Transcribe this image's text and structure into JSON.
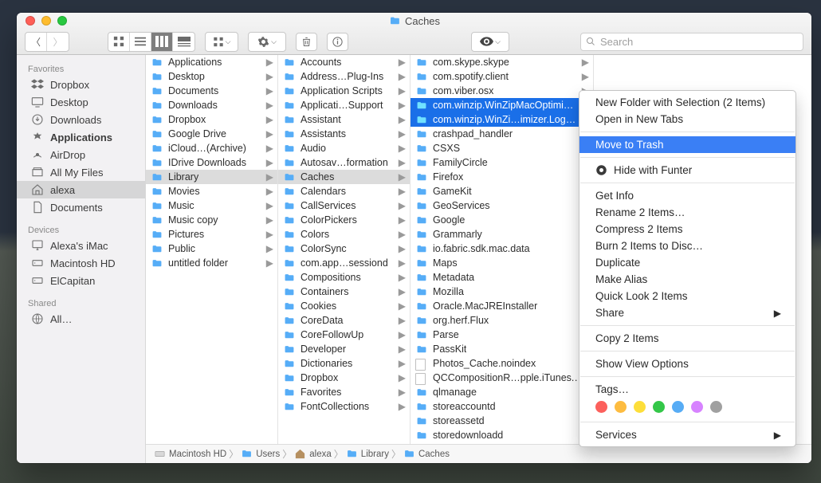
{
  "window": {
    "title": "Caches"
  },
  "search": {
    "placeholder": "Search"
  },
  "sidebar": {
    "sections": [
      {
        "header": "Favorites",
        "items": [
          {
            "icon": "dropbox",
            "label": "Dropbox"
          },
          {
            "icon": "desktop",
            "label": "Desktop"
          },
          {
            "icon": "downloads",
            "label": "Downloads"
          },
          {
            "icon": "apps",
            "label": "Applications",
            "bold": true
          },
          {
            "icon": "airdrop",
            "label": "AirDrop"
          },
          {
            "icon": "allfiles",
            "label": "All My Files"
          },
          {
            "icon": "home",
            "label": "alexa",
            "selected": true
          },
          {
            "icon": "doc",
            "label": "Documents"
          }
        ]
      },
      {
        "header": "Devices",
        "items": [
          {
            "icon": "imac",
            "label": "Alexa's iMac"
          },
          {
            "icon": "hd",
            "label": "Macintosh HD"
          },
          {
            "icon": "hd",
            "label": "ElCapitan"
          }
        ]
      },
      {
        "header": "Shared",
        "items": [
          {
            "icon": "globe",
            "label": "All…"
          }
        ]
      }
    ]
  },
  "columns": [
    {
      "items": [
        {
          "t": "folder",
          "label": "Applications",
          "arrow": true
        },
        {
          "t": "folder",
          "label": "Desktop",
          "arrow": true
        },
        {
          "t": "folder",
          "label": "Documents",
          "arrow": true
        },
        {
          "t": "folder",
          "label": "Downloads",
          "arrow": true
        },
        {
          "t": "folder",
          "label": "Dropbox",
          "arrow": true
        },
        {
          "t": "folder",
          "label": "Google Drive",
          "arrow": true
        },
        {
          "t": "folder",
          "label": "iCloud…(Archive)",
          "arrow": true
        },
        {
          "t": "folder",
          "label": "IDrive Downloads",
          "arrow": true
        },
        {
          "t": "folder",
          "label": "Library",
          "arrow": true,
          "selected": "grey"
        },
        {
          "t": "folder",
          "label": "Movies",
          "arrow": true
        },
        {
          "t": "folder",
          "label": "Music",
          "arrow": true
        },
        {
          "t": "folder",
          "label": "Music copy",
          "arrow": true
        },
        {
          "t": "img",
          "label": "Pictures",
          "arrow": true
        },
        {
          "t": "folder",
          "label": "Public",
          "arrow": true
        },
        {
          "t": "folder",
          "label": "untitled folder",
          "arrow": true
        }
      ]
    },
    {
      "items": [
        {
          "t": "folder",
          "label": "Accounts",
          "arrow": true
        },
        {
          "t": "folder",
          "label": "Address…Plug-Ins",
          "arrow": true
        },
        {
          "t": "folder",
          "label": "Application Scripts",
          "arrow": true
        },
        {
          "t": "folder",
          "label": "Applicati…Support",
          "arrow": true
        },
        {
          "t": "folder",
          "label": "Assistant",
          "arrow": true
        },
        {
          "t": "folder",
          "label": "Assistants",
          "arrow": true
        },
        {
          "t": "folder",
          "label": "Audio",
          "arrow": true
        },
        {
          "t": "folder",
          "label": "Autosav…formation",
          "arrow": true
        },
        {
          "t": "folder",
          "label": "Caches",
          "arrow": true,
          "selected": "grey"
        },
        {
          "t": "folder",
          "label": "Calendars",
          "arrow": true
        },
        {
          "t": "folder",
          "label": "CallServices",
          "arrow": true
        },
        {
          "t": "folder",
          "label": "ColorPickers",
          "arrow": true
        },
        {
          "t": "folder",
          "label": "Colors",
          "arrow": true
        },
        {
          "t": "folder",
          "label": "ColorSync",
          "arrow": true
        },
        {
          "t": "folder",
          "label": "com.app…sessiond",
          "arrow": true
        },
        {
          "t": "folder",
          "label": "Compositions",
          "arrow": true
        },
        {
          "t": "folder",
          "label": "Containers",
          "arrow": true
        },
        {
          "t": "folder",
          "label": "Cookies",
          "arrow": true
        },
        {
          "t": "folder",
          "label": "CoreData",
          "arrow": true
        },
        {
          "t": "folder",
          "label": "CoreFollowUp",
          "arrow": true
        },
        {
          "t": "folder",
          "label": "Developer",
          "arrow": true
        },
        {
          "t": "folder",
          "label": "Dictionaries",
          "arrow": true
        },
        {
          "t": "folder",
          "label": "Dropbox",
          "arrow": true
        },
        {
          "t": "folder",
          "label": "Favorites",
          "arrow": true
        },
        {
          "t": "folder",
          "label": "FontCollections",
          "arrow": true
        }
      ]
    },
    {
      "items": [
        {
          "t": "folder",
          "label": "com.skype.skype",
          "arrow": true
        },
        {
          "t": "folder",
          "label": "com.spotify.client",
          "arrow": true
        },
        {
          "t": "folder",
          "label": "com.viber.osx",
          "arrow": true
        },
        {
          "t": "folder",
          "label": "com.winzip.WinZipMacOptimizer",
          "arrow": true,
          "selected": "blue"
        },
        {
          "t": "folder",
          "label": "com.winzip.WinZi…imizer.LoginHel",
          "arrow": true,
          "selected": "blue"
        },
        {
          "t": "folder",
          "label": "crashpad_handler",
          "arrow": true
        },
        {
          "t": "folder",
          "label": "CSXS",
          "arrow": true
        },
        {
          "t": "folder",
          "label": "FamilyCircle",
          "arrow": true
        },
        {
          "t": "folder",
          "label": "Firefox",
          "arrow": true
        },
        {
          "t": "folder",
          "label": "GameKit",
          "arrow": true
        },
        {
          "t": "folder",
          "label": "GeoServices",
          "arrow": true
        },
        {
          "t": "folder",
          "label": "Google",
          "arrow": true
        },
        {
          "t": "folder",
          "label": "Grammarly",
          "arrow": true
        },
        {
          "t": "folder",
          "label": "io.fabric.sdk.mac.data",
          "arrow": true
        },
        {
          "t": "folder",
          "label": "Maps",
          "arrow": true
        },
        {
          "t": "folder",
          "label": "Metadata",
          "arrow": true
        },
        {
          "t": "folder",
          "label": "Mozilla",
          "arrow": true
        },
        {
          "t": "folder",
          "label": "Oracle.MacJREInstaller",
          "arrow": true
        },
        {
          "t": "folder",
          "label": "org.herf.Flux",
          "arrow": true
        },
        {
          "t": "folder",
          "label": "Parse",
          "arrow": true
        },
        {
          "t": "folder",
          "label": "PassKit",
          "arrow": true
        },
        {
          "t": "doc",
          "label": "Photos_Cache.noindex"
        },
        {
          "t": "doc",
          "label": "QCCompositionR…pple.iTunes.cac"
        },
        {
          "t": "folder",
          "label": "qlmanage",
          "arrow": true
        },
        {
          "t": "folder",
          "label": "storeaccountd",
          "arrow": true
        },
        {
          "t": "folder",
          "label": "storeassetd",
          "arrow": true
        },
        {
          "t": "folder",
          "label": "storedownloadd",
          "arrow": true
        }
      ]
    }
  ],
  "pathbar": [
    {
      "icon": "hd",
      "label": "Macintosh HD"
    },
    {
      "icon": "folder",
      "label": "Users"
    },
    {
      "icon": "home",
      "label": "alexa"
    },
    {
      "icon": "folder",
      "label": "Library"
    },
    {
      "icon": "folder",
      "label": "Caches"
    }
  ],
  "contextmenu": {
    "groups": [
      [
        {
          "label": "New Folder with Selection (2 Items)"
        },
        {
          "label": "Open in New Tabs"
        }
      ],
      [
        {
          "label": "Move to Trash",
          "selected": true
        }
      ],
      [
        {
          "label": "Hide with Funter",
          "icon": "funter"
        }
      ],
      [
        {
          "label": "Get Info"
        },
        {
          "label": "Rename 2 Items…"
        },
        {
          "label": "Compress 2 Items"
        },
        {
          "label": "Burn 2 Items to Disc…"
        },
        {
          "label": "Duplicate"
        },
        {
          "label": "Make Alias"
        },
        {
          "label": "Quick Look 2 Items"
        },
        {
          "label": "Share",
          "sub": true
        }
      ],
      [
        {
          "label": "Copy 2 Items"
        }
      ],
      [
        {
          "label": "Show View Options"
        }
      ],
      [
        {
          "label": "Tags…"
        }
      ]
    ],
    "tags": [
      "#fc605c",
      "#fdbc40",
      "#fdde3a",
      "#34c749",
      "#57acf5",
      "#d783ff",
      "#a0a0a0"
    ],
    "footer": [
      {
        "label": "Services",
        "sub": true
      }
    ]
  }
}
